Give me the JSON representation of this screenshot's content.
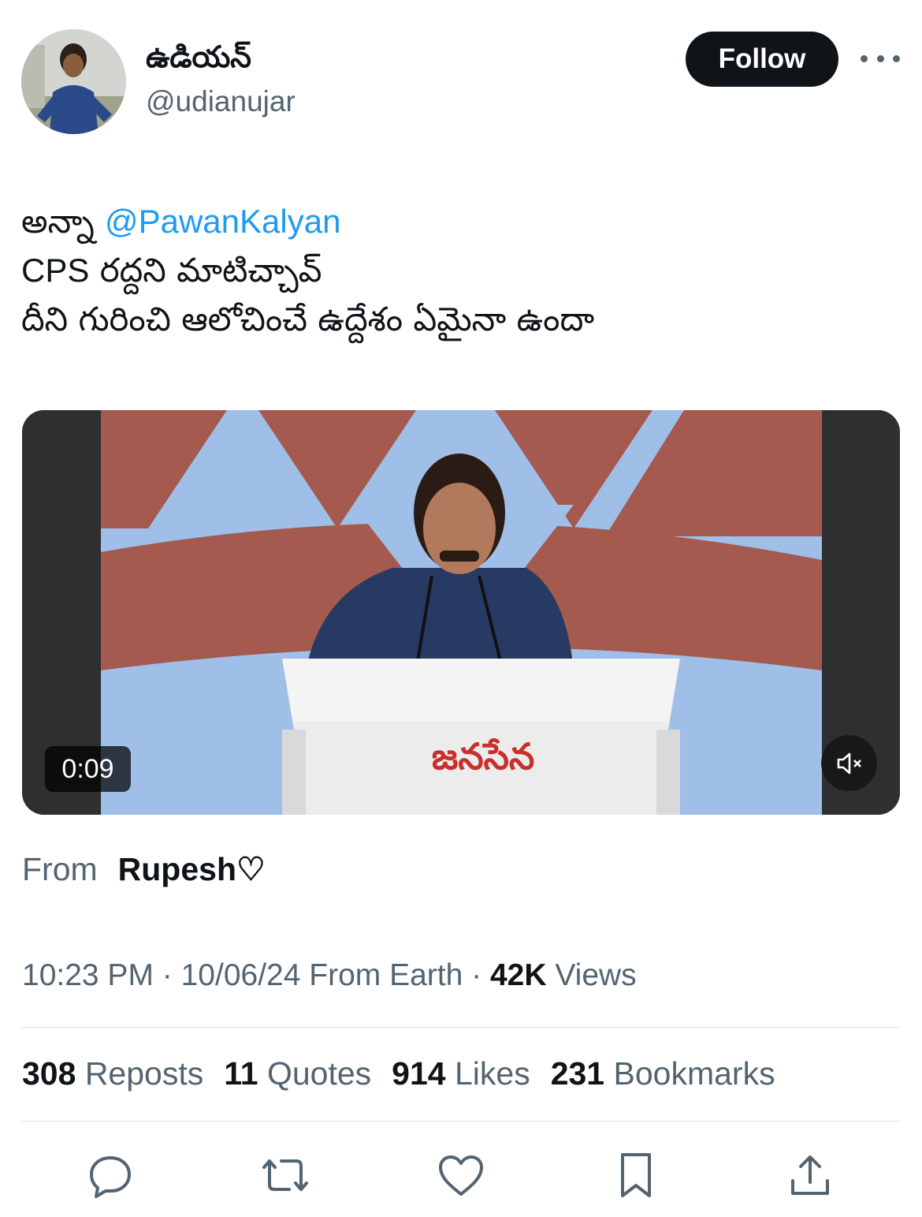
{
  "author": {
    "display_name": "ఉడియన్",
    "handle": "@udianujar"
  },
  "follow_button": {
    "label": "Follow"
  },
  "tweet": {
    "line1_prefix": "అన్నా ",
    "line1_mention": "@PawanKalyan",
    "line2_latin": "CPS",
    "line2_rest": " రద్దని మాటిచ్చావ్",
    "line3": "దీని గురించి ఆలోచించే ఉద్దేశం ఏమైనా ఉందా"
  },
  "media": {
    "duration": "0:09",
    "podium_text": "జనసేన"
  },
  "source": {
    "label": "From",
    "name": "Rupesh♡"
  },
  "meta": {
    "time": "10:23 PM",
    "sep1": " · ",
    "date": "10/06/24",
    "location": " From Earth",
    "sep2": " · ",
    "views_count": "42K",
    "views_label": " Views"
  },
  "stats": [
    {
      "count": "308",
      "label": " Reposts"
    },
    {
      "count": "11",
      "label": " Quotes"
    },
    {
      "count": "914",
      "label": " Likes"
    },
    {
      "count": "231",
      "label": " Bookmarks"
    }
  ],
  "colors": {
    "accent": "#1d9bf0",
    "text": "#0f1419",
    "muted": "#536471",
    "divider": "#dfe3e6",
    "banner_blue": "#9fbfe8",
    "banner_red": "#a45a4e"
  },
  "icons": [
    "reply-icon",
    "repost-icon",
    "like-icon",
    "bookmark-icon",
    "share-icon",
    "mute-icon",
    "more-icon"
  ]
}
